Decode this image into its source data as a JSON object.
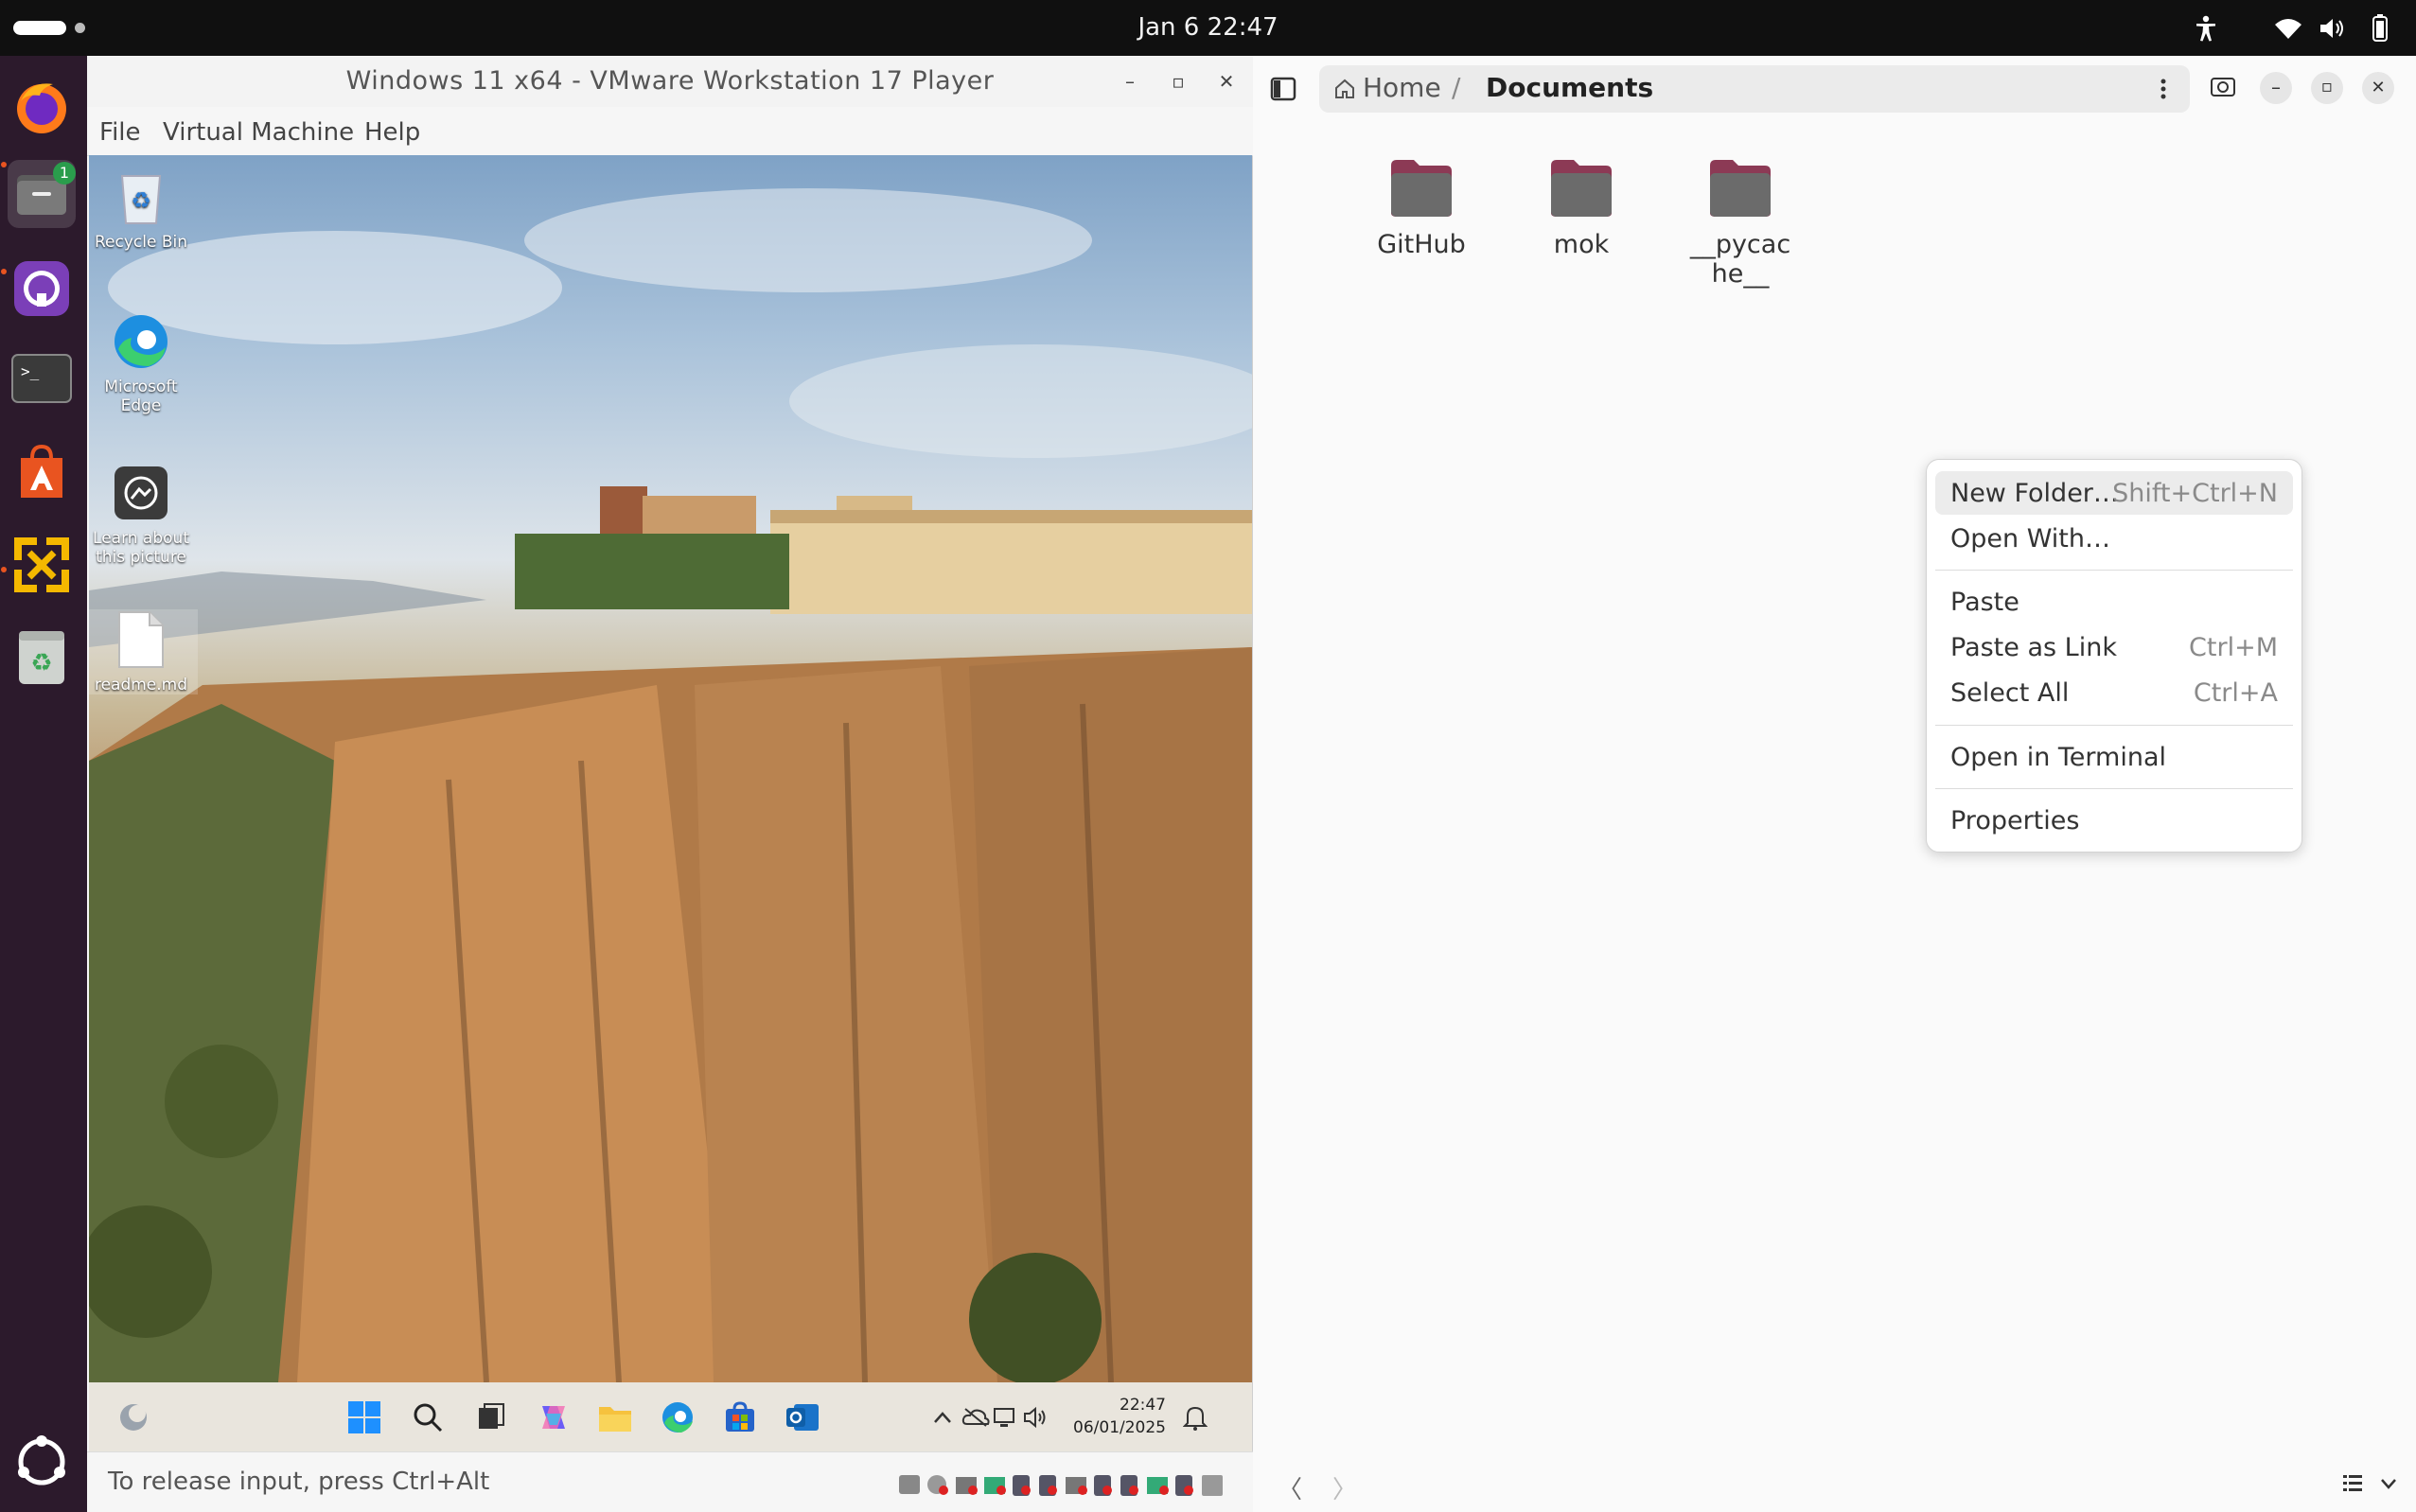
{
  "topbar": {
    "clock": "Jan 6  22:47"
  },
  "dock": {
    "items": [
      "firefox",
      "files",
      "github-desktop",
      "terminal",
      "app-center",
      "vmware-player",
      "trash",
      "show-apps"
    ],
    "files_badge": "1"
  },
  "vmware": {
    "title": "Windows 11 x64 - VMware Workstation 17 Player",
    "menu": [
      "File",
      "Virtual Machine",
      "Help"
    ],
    "status": "To release input, press Ctrl+Alt",
    "desktop_icons": [
      {
        "label": "Recycle Bin"
      },
      {
        "label": "Microsoft Edge"
      },
      {
        "label": "Learn about this picture"
      },
      {
        "label": "readme.md"
      }
    ],
    "taskbar": {
      "time": "22:47",
      "date": "06/01/2025"
    }
  },
  "files": {
    "path": {
      "home": "Home",
      "separator": "/",
      "current": "Documents"
    },
    "folders": [
      "GitHub",
      "mok",
      "__pycache__"
    ],
    "folder_color": "#8c3a55"
  },
  "context_menu": {
    "items": [
      {
        "label": "New Folder…",
        "shortcut": "Shift+Ctrl+N"
      },
      {
        "label": "Open With…",
        "shortcut": ""
      },
      {
        "label": "Paste",
        "shortcut": ""
      },
      {
        "label": "Paste as Link",
        "shortcut": "Ctrl+M"
      },
      {
        "label": "Select All",
        "shortcut": "Ctrl+A"
      },
      {
        "label": "Open in Terminal",
        "shortcut": ""
      },
      {
        "label": "Properties",
        "shortcut": ""
      }
    ]
  }
}
